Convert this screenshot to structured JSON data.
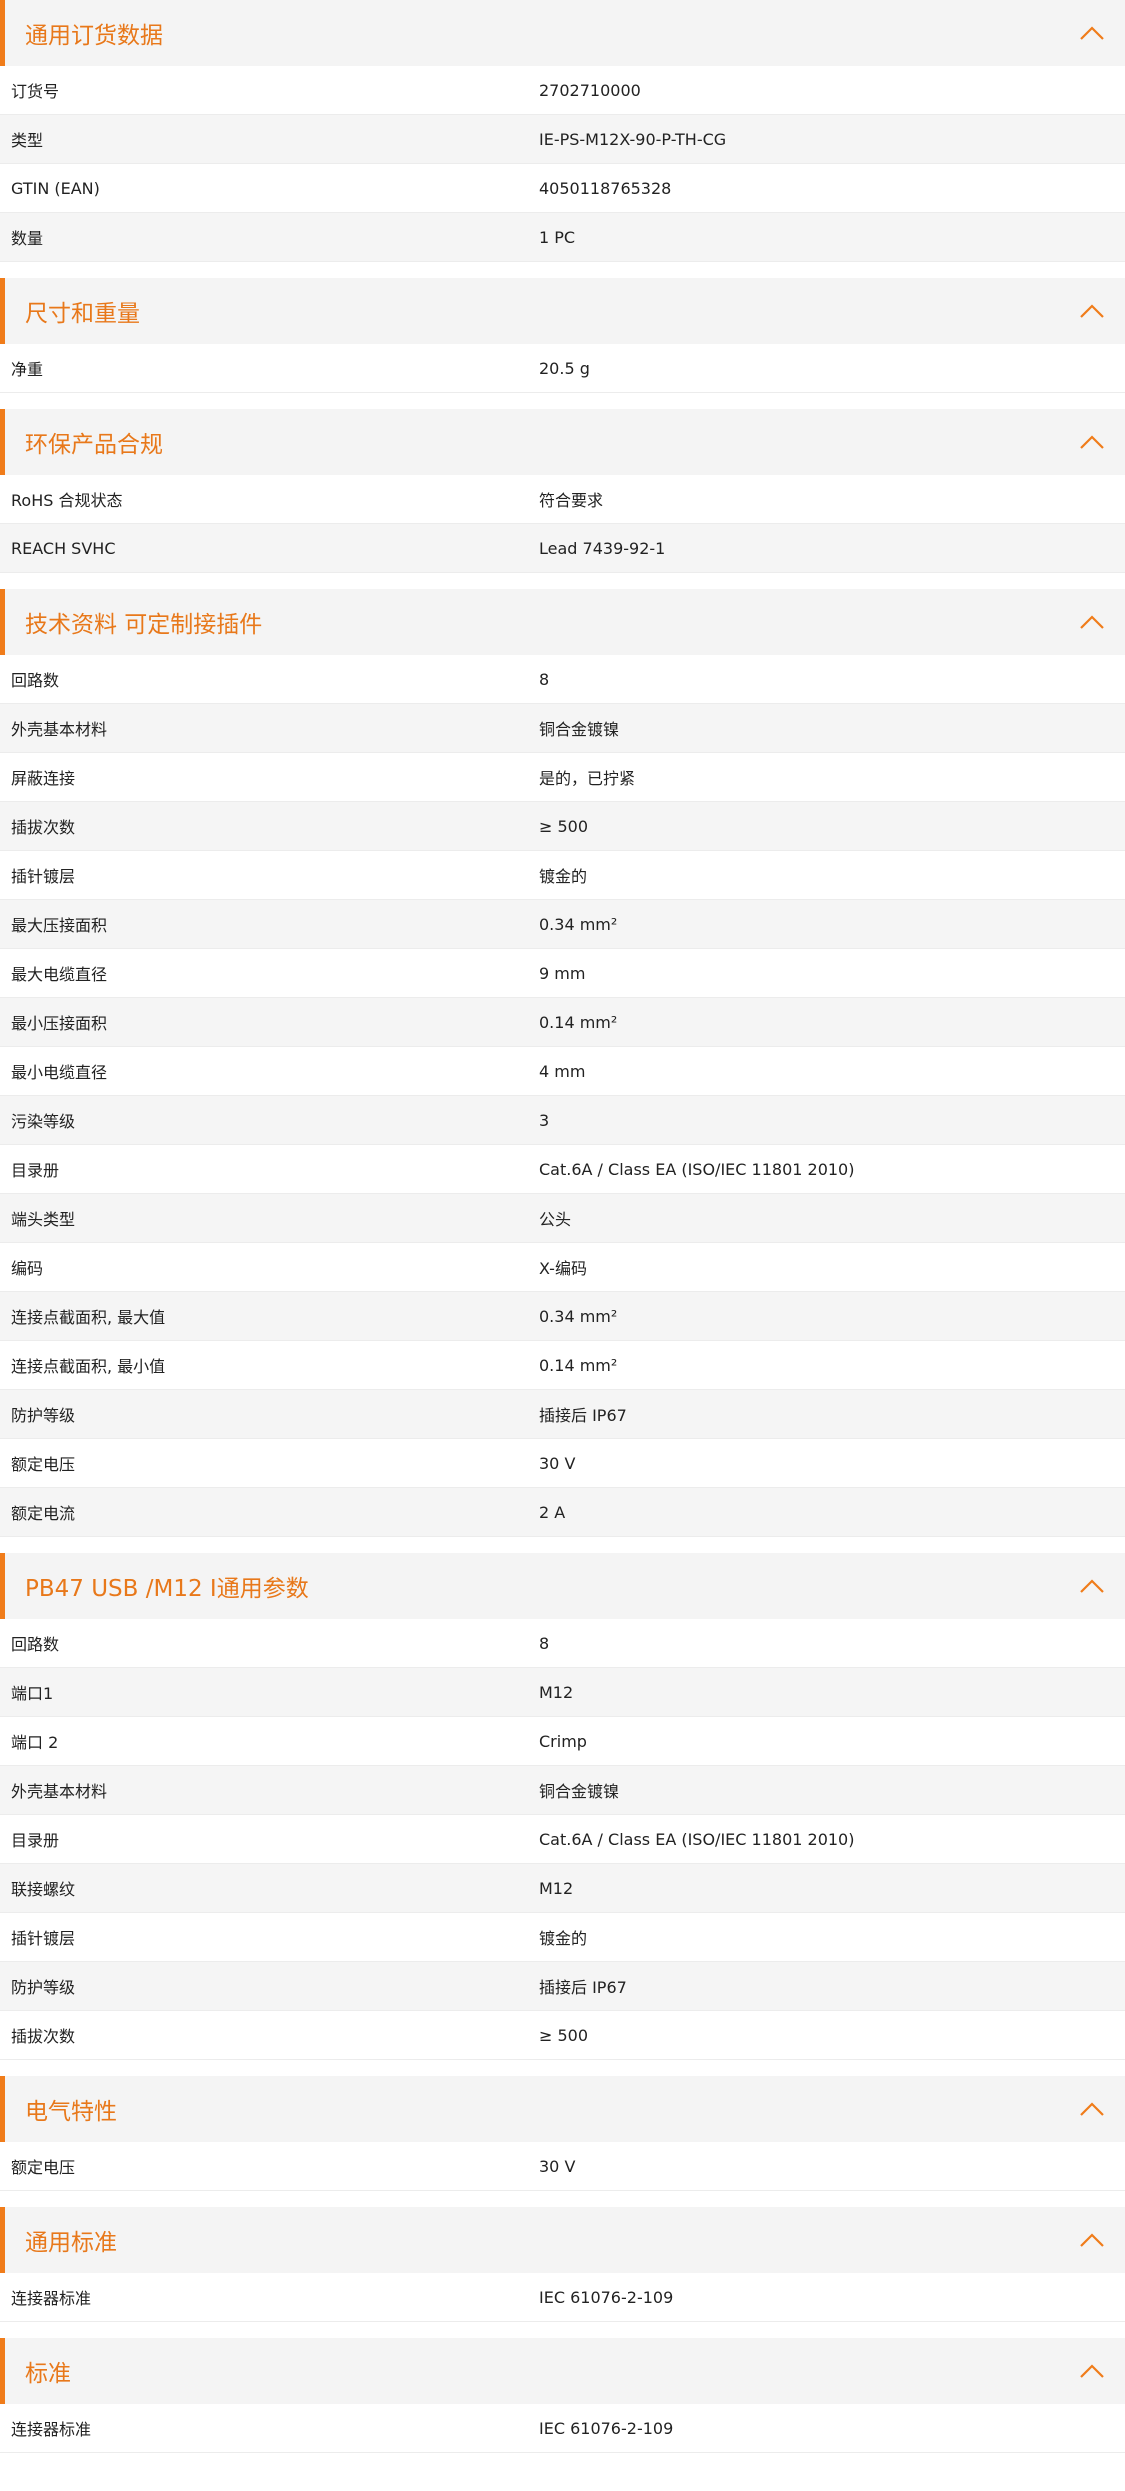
{
  "colors": {
    "accent": "#f07c1a",
    "title": "#e8781a",
    "header_bg": "#f4f4f4",
    "row_alt": "#f5f5f5"
  },
  "sections": [
    {
      "title": "通用订货数据",
      "icon": "chevron-up-icon",
      "rows": [
        {
          "label": "订货号",
          "value": "2702710000"
        },
        {
          "label": "类型",
          "value": "IE-PS-M12X-90-P-TH-CG"
        },
        {
          "label": "GTIN (EAN)",
          "value": "4050118765328"
        },
        {
          "label": "数量",
          "value": "1  PC"
        }
      ]
    },
    {
      "title": "尺寸和重量",
      "icon": "chevron-up-icon",
      "rows": [
        {
          "label": "净重",
          "value": "20.5  g"
        }
      ]
    },
    {
      "title": "环保产品合规",
      "icon": "chevron-up-icon",
      "rows": [
        {
          "label": "RoHS 合规状态",
          "value": "符合要求"
        },
        {
          "label": "REACH SVHC",
          "value": "Lead 7439-92-1"
        }
      ]
    },
    {
      "title": "技术资料 可定制接插件",
      "icon": "chevron-up-icon",
      "rows": [
        {
          "label": "回路数",
          "value": "8"
        },
        {
          "label": "外壳基本材料",
          "value": "铜合金镀镍"
        },
        {
          "label": "屏蔽连接",
          "value": "是的，已拧紧"
        },
        {
          "label": "插拔次数",
          "value": "≥ 500"
        },
        {
          "label": "插针镀层",
          "value": "镀金的"
        },
        {
          "label": "最大压接面积",
          "value": "0.34  mm²"
        },
        {
          "label": "最大电缆直径",
          "value": "9  mm"
        },
        {
          "label": "最小压接面积",
          "value": "0.14  mm²"
        },
        {
          "label": "最小电缆直径",
          "value": "4  mm"
        },
        {
          "label": "污染等级",
          "value": "3"
        },
        {
          "label": "目录册",
          "value": "Cat.6A / Class EA (ISO/IEC 11801 2010)"
        },
        {
          "label": "端头类型",
          "value": "公头"
        },
        {
          "label": "编码",
          "value": "X-编码"
        },
        {
          "label": "连接点截面积, 最大值",
          "value": "0.34  mm²"
        },
        {
          "label": "连接点截面积, 最小值",
          "value": "0.14  mm²"
        },
        {
          "label": "防护等级",
          "value": "插接后 IP67"
        },
        {
          "label": "额定电压",
          "value": "30  V"
        },
        {
          "label": "额定电流",
          "value": "2  A"
        }
      ]
    },
    {
      "title": "PB47 USB /M12 I通用参数",
      "icon": "chevron-up-icon",
      "rows": [
        {
          "label": "回路数",
          "value": "8"
        },
        {
          "label": "端口1",
          "value": "M12"
        },
        {
          "label": "端口 2",
          "value": "Crimp"
        },
        {
          "label": "外壳基本材料",
          "value": "铜合金镀镍"
        },
        {
          "label": "目录册",
          "value": "Cat.6A / Class EA (ISO/IEC 11801 2010)"
        },
        {
          "label": "联接螺纹",
          "value": "M12"
        },
        {
          "label": "插针镀层",
          "value": "镀金的"
        },
        {
          "label": "防护等级",
          "value": "插接后 IP67"
        },
        {
          "label": "插拔次数",
          "value": "≥ 500"
        }
      ]
    },
    {
      "title": "电气特性",
      "icon": "chevron-up-icon",
      "rows": [
        {
          "label": "额定电压",
          "value": "30  V"
        }
      ]
    },
    {
      "title": "通用标准",
      "icon": "chevron-up-icon",
      "rows": [
        {
          "label": "连接器标准",
          "value": "IEC 61076-2-109"
        }
      ]
    },
    {
      "title": "标准",
      "icon": "chevron-up-icon",
      "rows": [
        {
          "label": "连接器标准",
          "value": "IEC 61076-2-109"
        }
      ]
    }
  ]
}
